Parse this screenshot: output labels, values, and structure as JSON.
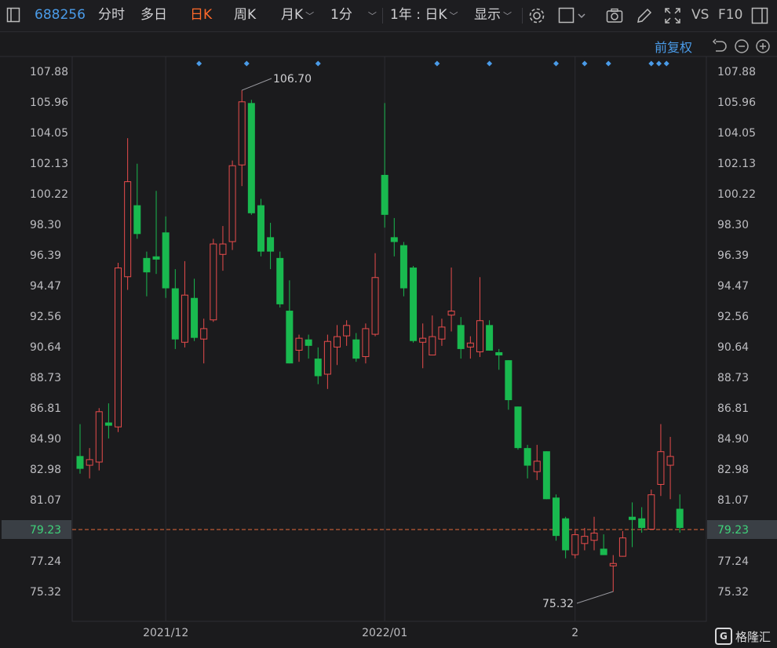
{
  "toolbar": {
    "code": "688256",
    "tab_time": "分时",
    "tab_multi": "多日",
    "tab_day": "日K",
    "tab_week": "周K",
    "tab_month": "月K",
    "tab_min": "1分",
    "range": "1年 : 日K",
    "display": "显示",
    "vs": "VS",
    "f10": "F10"
  },
  "adjust_label": "前复权",
  "watermark": "格隆汇",
  "chart_data": {
    "type": "candlestick",
    "yticks": [
      "107.88",
      "105.96",
      "104.05",
      "102.13",
      "100.22",
      "98.30",
      "96.39",
      "94.47",
      "92.56",
      "90.64",
      "88.73",
      "86.81",
      "84.90",
      "82.98",
      "81.07",
      "79.23",
      "77.24",
      "75.32"
    ],
    "ylim": [
      74.5,
      108.9
    ],
    "xlabels": [
      {
        "label": "2021/12",
        "index": 9
      },
      {
        "label": "2022/01",
        "index": 32
      },
      {
        "label": "2",
        "index": 52
      }
    ],
    "current_price": "79.23",
    "high_label": "106.70",
    "low_label": "75.32",
    "high_index": 17,
    "low_index": 56,
    "colors": {
      "up": "#e84c4c",
      "down": "#19b94f",
      "dashed": "#e66a3a",
      "marker": "#4a9be8",
      "bg": "#1b1b1d"
    },
    "markers": [
      12.5,
      17.5,
      25,
      37.5,
      43,
      50,
      53,
      55.5,
      60,
      60.8,
      61.6
    ],
    "candles": [
      {
        "o": 83.8,
        "h": 85.8,
        "l": 82.7,
        "c": 83.0
      },
      {
        "o": 83.2,
        "h": 84.3,
        "l": 82.4,
        "c": 83.6
      },
      {
        "o": 83.4,
        "h": 86.8,
        "l": 82.9,
        "c": 86.6
      },
      {
        "o": 85.9,
        "h": 87.1,
        "l": 84.9,
        "c": 85.7
      },
      {
        "o": 85.6,
        "h": 95.9,
        "l": 85.3,
        "c": 95.6
      },
      {
        "o": 95.0,
        "h": 103.7,
        "l": 94.2,
        "c": 101.0
      },
      {
        "o": 99.5,
        "h": 102.1,
        "l": 97.4,
        "c": 97.7
      },
      {
        "o": 96.2,
        "h": 96.6,
        "l": 93.8,
        "c": 95.3
      },
      {
        "o": 96.3,
        "h": 100.4,
        "l": 95.2,
        "c": 96.1
      },
      {
        "o": 97.8,
        "h": 98.8,
        "l": 93.7,
        "c": 94.3
      },
      {
        "o": 94.3,
        "h": 95.5,
        "l": 90.5,
        "c": 91.1
      },
      {
        "o": 90.9,
        "h": 96.0,
        "l": 90.6,
        "c": 93.9
      },
      {
        "o": 93.7,
        "h": 94.9,
        "l": 91.0,
        "c": 91.2
      },
      {
        "o": 91.1,
        "h": 92.4,
        "l": 89.6,
        "c": 91.8
      },
      {
        "o": 92.3,
        "h": 97.4,
        "l": 92.2,
        "c": 97.1
      },
      {
        "o": 96.4,
        "h": 98.2,
        "l": 95.4,
        "c": 97.1
      },
      {
        "o": 97.2,
        "h": 102.3,
        "l": 96.7,
        "c": 102.0
      },
      {
        "o": 102.0,
        "h": 106.7,
        "l": 100.7,
        "c": 106.0
      },
      {
        "o": 105.9,
        "h": 106.1,
        "l": 98.9,
        "c": 99.0
      },
      {
        "o": 99.5,
        "h": 99.9,
        "l": 96.3,
        "c": 96.6
      },
      {
        "o": 97.5,
        "h": 98.4,
        "l": 95.5,
        "c": 96.6
      },
      {
        "o": 96.2,
        "h": 96.6,
        "l": 93.1,
        "c": 93.3
      },
      {
        "o": 92.9,
        "h": 94.8,
        "l": 89.6,
        "c": 89.6
      },
      {
        "o": 90.4,
        "h": 91.4,
        "l": 89.7,
        "c": 91.2
      },
      {
        "o": 91.1,
        "h": 91.4,
        "l": 89.9,
        "c": 90.7
      },
      {
        "o": 89.9,
        "h": 90.6,
        "l": 88.3,
        "c": 88.8
      },
      {
        "o": 88.9,
        "h": 91.4,
        "l": 88.0,
        "c": 91.0
      },
      {
        "o": 90.6,
        "h": 92.0,
        "l": 89.5,
        "c": 91.3
      },
      {
        "o": 91.3,
        "h": 92.3,
        "l": 90.7,
        "c": 92.0
      },
      {
        "o": 91.1,
        "h": 91.5,
        "l": 89.7,
        "c": 89.9
      },
      {
        "o": 90.0,
        "h": 92.1,
        "l": 89.6,
        "c": 91.8
      },
      {
        "o": 91.4,
        "h": 96.5,
        "l": 91.3,
        "c": 95.0
      },
      {
        "o": 101.4,
        "h": 105.9,
        "l": 98.1,
        "c": 98.9
      },
      {
        "o": 97.5,
        "h": 98.7,
        "l": 96.3,
        "c": 97.2
      },
      {
        "o": 97.0,
        "h": 97.2,
        "l": 93.8,
        "c": 94.3
      },
      {
        "o": 95.6,
        "h": 95.7,
        "l": 90.9,
        "c": 91.0
      },
      {
        "o": 90.9,
        "h": 92.1,
        "l": 89.3,
        "c": 91.2
      },
      {
        "o": 90.1,
        "h": 92.6,
        "l": 90.1,
        "c": 91.3
      },
      {
        "o": 91.1,
        "h": 92.4,
        "l": 90.7,
        "c": 91.9
      },
      {
        "o": 92.6,
        "h": 95.6,
        "l": 91.6,
        "c": 92.9
      },
      {
        "o": 92.0,
        "h": 92.5,
        "l": 89.9,
        "c": 90.5
      },
      {
        "o": 90.6,
        "h": 91.3,
        "l": 89.9,
        "c": 90.9
      },
      {
        "o": 90.3,
        "h": 95.0,
        "l": 90.0,
        "c": 92.3
      },
      {
        "o": 92.0,
        "h": 92.3,
        "l": 90.4,
        "c": 90.4
      },
      {
        "o": 90.3,
        "h": 90.5,
        "l": 89.2,
        "c": 90.1
      },
      {
        "o": 89.8,
        "h": 89.8,
        "l": 86.7,
        "c": 87.3
      },
      {
        "o": 86.9,
        "h": 86.9,
        "l": 84.2,
        "c": 84.3
      },
      {
        "o": 84.3,
        "h": 84.5,
        "l": 82.4,
        "c": 83.2
      },
      {
        "o": 82.8,
        "h": 84.5,
        "l": 82.3,
        "c": 83.5
      },
      {
        "o": 84.1,
        "h": 84.1,
        "l": 81.1,
        "c": 81.1
      },
      {
        "o": 81.2,
        "h": 81.4,
        "l": 78.5,
        "c": 78.8
      },
      {
        "o": 79.9,
        "h": 80.0,
        "l": 77.4,
        "c": 77.9
      },
      {
        "o": 77.6,
        "h": 79.2,
        "l": 77.4,
        "c": 78.9
      },
      {
        "o": 78.3,
        "h": 79.3,
        "l": 77.9,
        "c": 78.8
      },
      {
        "o": 78.5,
        "h": 80.0,
        "l": 77.9,
        "c": 79.0
      },
      {
        "o": 78.0,
        "h": 78.9,
        "l": 77.6,
        "c": 77.6
      },
      {
        "o": 76.9,
        "h": 77.6,
        "l": 75.3,
        "c": 77.1
      },
      {
        "o": 77.5,
        "h": 79.1,
        "l": 77.5,
        "c": 78.7
      },
      {
        "o": 80.0,
        "h": 80.9,
        "l": 78.1,
        "c": 79.8
      },
      {
        "o": 79.9,
        "h": 80.6,
        "l": 79.0,
        "c": 79.3
      },
      {
        "o": 79.2,
        "h": 81.7,
        "l": 79.2,
        "c": 81.4
      },
      {
        "o": 82.0,
        "h": 85.8,
        "l": 81.3,
        "c": 84.1
      },
      {
        "o": 83.2,
        "h": 85.0,
        "l": 81.1,
        "c": 83.8
      },
      {
        "o": 80.5,
        "h": 81.4,
        "l": 79.0,
        "c": 79.3
      }
    ]
  }
}
